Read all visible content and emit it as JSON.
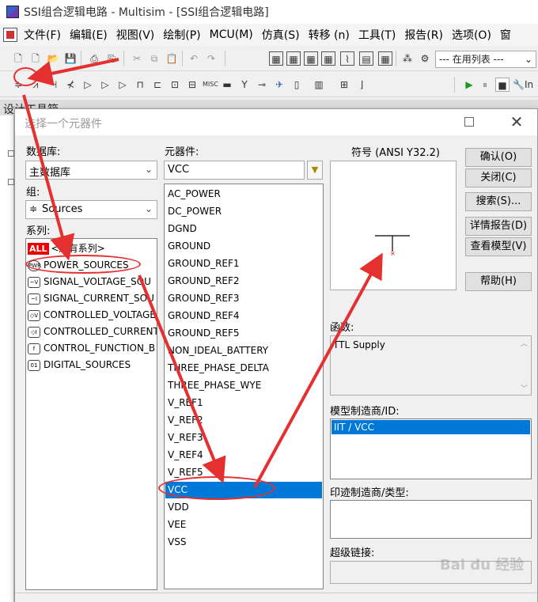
{
  "window": {
    "title": "SSI组合逻辑电路 - Multisim - [SSI组合逻辑电路]"
  },
  "menu": [
    "文件(F)",
    "编辑(E)",
    "视图(V)",
    "绘制(P)",
    "MCU(M)",
    "仿真(S)",
    "转移 (n)",
    "工具(T)",
    "报告(R)",
    "选项(O)",
    "窗"
  ],
  "toolbar": {
    "in_use_list": "--- 在用列表 ---",
    "truncated_text": "In"
  },
  "background": {
    "design_toolbox_tab": "设计工具箱"
  },
  "dialog": {
    "title": "选择一个元器件",
    "database_label": "数据库:",
    "database_value": "主数据库",
    "group_label": "组:",
    "group_value": "Sources",
    "family_label": "系列:",
    "families": [
      {
        "label": "<所有系列>",
        "icon": "ALL"
      },
      {
        "label": "POWER_SOURCES",
        "icon": "PWR"
      },
      {
        "label": "SIGNAL_VOLTAGE_SOU",
        "icon": "~V"
      },
      {
        "label": "SIGNAL_CURRENT_SOU",
        "icon": "~I"
      },
      {
        "label": "CONTROLLED_VOLTAGE",
        "icon": "◇V"
      },
      {
        "label": "CONTROLLED_CURRENT",
        "icon": "◇I"
      },
      {
        "label": "CONTROL_FUNCTION_B",
        "icon": "f"
      },
      {
        "label": "DIGITAL_SOURCES",
        "icon": "01"
      }
    ],
    "component_label": "元器件:",
    "component_search": "VCC",
    "components": [
      "AC_POWER",
      "DC_POWER",
      "DGND",
      "GROUND",
      "GROUND_REF1",
      "GROUND_REF2",
      "GROUND_REF3",
      "GROUND_REF4",
      "GROUND_REF5",
      "NON_IDEAL_BATTERY",
      "THREE_PHASE_DELTA",
      "THREE_PHASE_WYE",
      "V_REF1",
      "V_REF2",
      "V_REF3",
      "V_REF4",
      "V_REF5",
      "VCC",
      "VDD",
      "VEE",
      "VSS"
    ],
    "selected_component": "VCC",
    "symbol_label": "符号 (ANSI Y32.2)",
    "function_label": "函数:",
    "function_value": "TTL Supply",
    "model_label": "模型制造商/ID:",
    "model_value": "IIT / VCC",
    "footprint_label": "印迹制造商/类型:",
    "hyperlink_label": "超级链接:",
    "buttons": {
      "ok": "确认(O)",
      "close": "关闭(C)",
      "search": "搜索(S)...",
      "report": "详情报告(D)",
      "view_model": "查看模型(V)",
      "help": "帮助(H)"
    }
  },
  "watermark": "Bai du 经验"
}
